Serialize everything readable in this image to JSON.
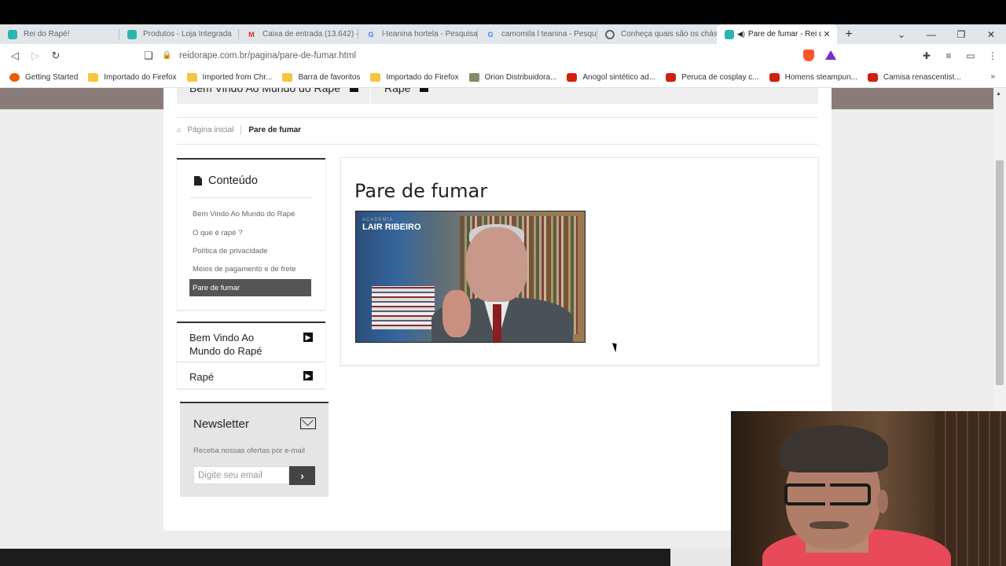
{
  "browser": {
    "tabs": [
      {
        "title": "Rei do Rapé!",
        "favicon": "loja-integrada-icon",
        "color": "#2bb5b0"
      },
      {
        "title": "Produtos - Loja Integrada",
        "favicon": "loja-integrada-icon",
        "color": "#2bb5b0"
      },
      {
        "title": "Caixa de entrada (13.642) -",
        "favicon": "gmail-icon",
        "color": "#d93025"
      },
      {
        "title": "l-teanina hortela - Pesquisa",
        "favicon": "google-icon",
        "color": "#4285f4"
      },
      {
        "title": "camomila l teanina - Pesqu",
        "favicon": "google-icon",
        "color": "#4285f4"
      },
      {
        "title": "Conheça quais são os chás",
        "favicon": "globe-icon",
        "color": "#5f6368"
      },
      {
        "title": "Pare de fumar - Rei do",
        "favicon": "loja-integrada-icon",
        "color": "#2bb5b0",
        "active": true
      }
    ],
    "url": "reidorape.com.br/pagina/pare-de-fumar.html",
    "bookmarks": [
      {
        "label": "Getting Started",
        "icon": "firefox-icon"
      },
      {
        "label": "Importado do Firefox",
        "icon": "folder-icon"
      },
      {
        "label": "Imported from Chr...",
        "icon": "folder-icon"
      },
      {
        "label": "Barra de favoritos",
        "icon": "folder-icon"
      },
      {
        "label": "Importado do Firefox",
        "icon": "folder-icon"
      },
      {
        "label": "Orion Distribuidora...",
        "icon": "orion-icon"
      },
      {
        "label": "Anogol sintético ad...",
        "icon": "aliexpress-icon"
      },
      {
        "label": "Peruca de cosplay c...",
        "icon": "aliexpress-icon"
      },
      {
        "label": "Homens steampun...",
        "icon": "aliexpress-icon"
      },
      {
        "label": "Camisa renascentist...",
        "icon": "aliexpress-icon"
      }
    ],
    "more_bookmarks": "»"
  },
  "site": {
    "top_menu": [
      "Bem Vindo Ao Mundo do Rapé",
      "Rapé"
    ],
    "breadcrumb": {
      "home": "Página inicial",
      "current": "Pare de fumar"
    },
    "sidebar": {
      "title": "Conteúdo",
      "items": [
        {
          "label": "Bem Vindo Ao Mundo do Rapé"
        },
        {
          "label": "O que é rapé ?"
        },
        {
          "label": "Política de privacidade"
        },
        {
          "label": "Meios de pagamento e de frete"
        },
        {
          "label": "Pare de fumar",
          "active": true
        }
      ]
    },
    "categories": [
      {
        "label": "Bem Vindo Ao Mundo do Rapé"
      },
      {
        "label": "Rapé"
      }
    ],
    "newsletter": {
      "title": "Newsletter",
      "description": "Receba nossas ofertas por e-mail",
      "placeholder": "Digite seu email"
    },
    "content": {
      "title": "Pare de fumar",
      "video": {
        "brand_line1": "ACADEMIA",
        "brand_line2": "LAIR RIBEIRO"
      }
    }
  },
  "colors": {
    "accent_dark": "#555555",
    "header_band": "#8a7a78"
  }
}
